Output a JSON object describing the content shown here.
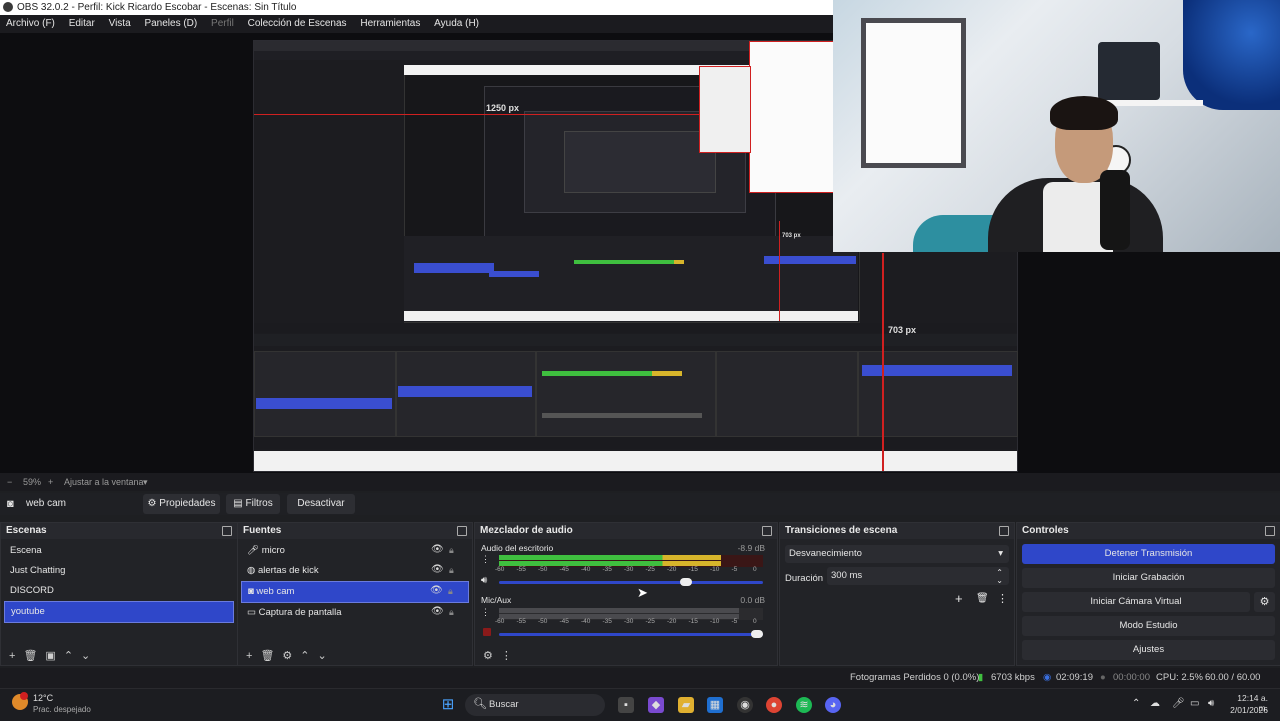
{
  "window": {
    "title": "OBS 32.0.2 - Perfil: Kick Ricardo Escobar - Escenas: Sin Título"
  },
  "menu": {
    "items": [
      "Archivo (F)",
      "Editar",
      "Vista",
      "Paneles (D)",
      "Perfil",
      "Colección de Escenas",
      "Herramientas",
      "Ayuda (H)"
    ]
  },
  "preview": {
    "label_1250": "1250 px",
    "label_703_top": "703 px",
    "label_703": "703 px"
  },
  "zoom": {
    "minus": "−",
    "value": "59%",
    "plus": "+",
    "fit": "Ajustar a la ventana"
  },
  "source_bar": {
    "source_name": "web cam",
    "properties": "Propiedades",
    "filters": "Filtros",
    "deactivate": "Desactivar"
  },
  "scenes": {
    "title": "Escenas",
    "items": [
      "Escena",
      "Just Chatting",
      "DISCORD",
      "youtube"
    ],
    "selected_index": 3
  },
  "sources": {
    "title": "Fuentes",
    "items": [
      {
        "label": "micro",
        "icon": "mic-icon"
      },
      {
        "label": "alertas de kick",
        "icon": "globe-icon"
      },
      {
        "label": "web cam",
        "icon": "camera-icon"
      },
      {
        "label": "Captura de pantalla",
        "icon": "monitor-icon"
      }
    ],
    "selected_index": 2
  },
  "mixer": {
    "title": "Mezclador de audio",
    "channels": [
      {
        "name": "Audio del escritorio",
        "db": "-8.9 dB",
        "level": 0.84,
        "volume": 0.72
      },
      {
        "name": "Mic/Aux",
        "db": "0.0 dB",
        "level": 0.0,
        "volume": 1.0
      }
    ],
    "ticks": [
      "-60",
      "-55",
      "-50",
      "-45",
      "-40",
      "-35",
      "-30",
      "-25",
      "-20",
      "-15",
      "-10",
      "-5",
      "0"
    ]
  },
  "transitions": {
    "title": "Transiciones de escena",
    "selected": "Desvanecimiento",
    "duration_label": "Duración",
    "duration_value": "300 ms"
  },
  "controls": {
    "title": "Controles",
    "buttons": [
      "Detener Transmisión",
      "Iniciar Grabación",
      "Iniciar Cámara Virtual",
      "Modo Estudio",
      "Ajustes"
    ]
  },
  "status": {
    "frames_dropped": "Fotogramas Perdidos 0 (0.0%)",
    "bitrate": "6703 kbps",
    "stream_time": "02:09:19",
    "rec_time": "00:00:00",
    "cpu": "CPU: 2.5%",
    "fps": "60.00 / 60.00 FPS"
  },
  "taskbar": {
    "temp": "12°C",
    "weather": "Prac. despejado",
    "search": "Buscar",
    "time": "12:14 a. m.",
    "date": "2/01/2026"
  },
  "colors": {
    "accent": "#2f47c9",
    "meter_green": "#3fbf3f",
    "meter_yellow": "#d7b52b",
    "meter_red": "#c03030"
  }
}
